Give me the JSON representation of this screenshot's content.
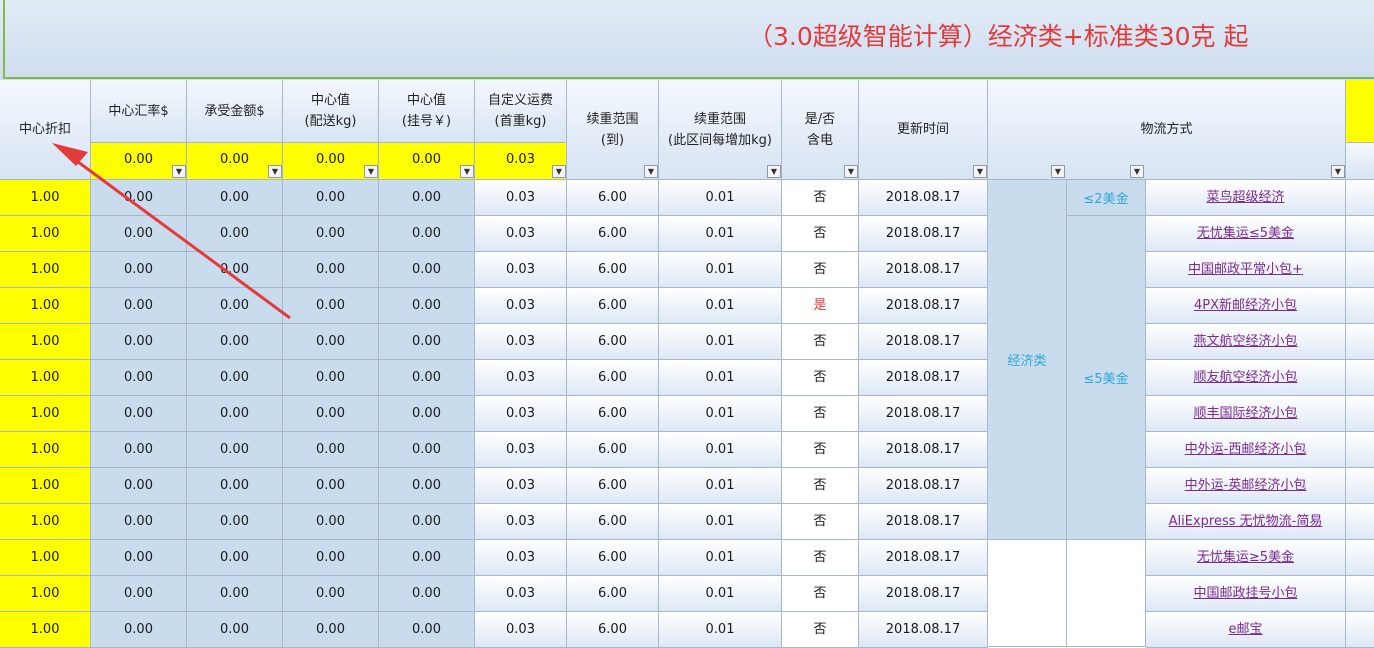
{
  "banner": {
    "title": "（3.0超级智能计算）经济类+标准类30克 起"
  },
  "headers": {
    "discount": "中心折扣",
    "rate": "中心汇率$",
    "amount": "承受金额$",
    "center_delivery": [
      "中心值",
      "(配送kg)"
    ],
    "center_registered": [
      "中心值",
      "(挂号￥)"
    ],
    "custom_freight": [
      "自定义运费",
      "(首重kg)"
    ],
    "continue_range_to": [
      "续重范围",
      "(到)"
    ],
    "continue_range_step": [
      "续重范围",
      "(此区间每增加kg)"
    ],
    "battery": [
      "是/否",
      "含电"
    ],
    "update_time": "更新时间",
    "shipping_method": "物流方式"
  },
  "inputs": {
    "rate": "0.00",
    "amount": "0.00",
    "center_delivery": "0.00",
    "center_registered": "0.00",
    "custom_freight": "0.03"
  },
  "groups": {
    "economy": "经济类",
    "le2": "≤2美金",
    "le5": "≤5美金"
  },
  "rows": [
    {
      "discount": "1.00",
      "rate": "0.00",
      "amount": "0.00",
      "delivery": "0.00",
      "registered": "0.00",
      "freight": "0.03",
      "range_to": "6.00",
      "range_step": "0.01",
      "battery": "否",
      "date": "2018.08.17",
      "method": "菜鸟超级经济"
    },
    {
      "discount": "1.00",
      "rate": "0.00",
      "amount": "0.00",
      "delivery": "0.00",
      "registered": "0.00",
      "freight": "0.03",
      "range_to": "6.00",
      "range_step": "0.01",
      "battery": "否",
      "date": "2018.08.17",
      "method": "无忧集运≤5美金"
    },
    {
      "discount": "1.00",
      "rate": "0.00",
      "amount": "0.00",
      "delivery": "0.00",
      "registered": "0.00",
      "freight": "0.03",
      "range_to": "6.00",
      "range_step": "0.01",
      "battery": "否",
      "date": "2018.08.17",
      "method": "中国邮政平常小包+"
    },
    {
      "discount": "1.00",
      "rate": "0.00",
      "amount": "0.00",
      "delivery": "0.00",
      "registered": "0.00",
      "freight": "0.03",
      "range_to": "6.00",
      "range_step": "0.01",
      "battery": "是",
      "date": "2018.08.17",
      "method": "4PX新邮经济小包"
    },
    {
      "discount": "1.00",
      "rate": "0.00",
      "amount": "0.00",
      "delivery": "0.00",
      "registered": "0.00",
      "freight": "0.03",
      "range_to": "6.00",
      "range_step": "0.01",
      "battery": "否",
      "date": "2018.08.17",
      "method": "燕文航空经济小包"
    },
    {
      "discount": "1.00",
      "rate": "0.00",
      "amount": "0.00",
      "delivery": "0.00",
      "registered": "0.00",
      "freight": "0.03",
      "range_to": "6.00",
      "range_step": "0.01",
      "battery": "否",
      "date": "2018.08.17",
      "method": "顺友航空经济小包"
    },
    {
      "discount": "1.00",
      "rate": "0.00",
      "amount": "0.00",
      "delivery": "0.00",
      "registered": "0.00",
      "freight": "0.03",
      "range_to": "6.00",
      "range_step": "0.01",
      "battery": "否",
      "date": "2018.08.17",
      "method": "顺丰国际经济小包"
    },
    {
      "discount": "1.00",
      "rate": "0.00",
      "amount": "0.00",
      "delivery": "0.00",
      "registered": "0.00",
      "freight": "0.03",
      "range_to": "6.00",
      "range_step": "0.01",
      "battery": "否",
      "date": "2018.08.17",
      "method": "中外运-西邮经济小包"
    },
    {
      "discount": "1.00",
      "rate": "0.00",
      "amount": "0.00",
      "delivery": "0.00",
      "registered": "0.00",
      "freight": "0.03",
      "range_to": "6.00",
      "range_step": "0.01",
      "battery": "否",
      "date": "2018.08.17",
      "method": "中外运-英邮经济小包"
    },
    {
      "discount": "1.00",
      "rate": "0.00",
      "amount": "0.00",
      "delivery": "0.00",
      "registered": "0.00",
      "freight": "0.03",
      "range_to": "6.00",
      "range_step": "0.01",
      "battery": "否",
      "date": "2018.08.17",
      "method": "AliExpress 无忧物流-简易"
    },
    {
      "discount": "1.00",
      "rate": "0.00",
      "amount": "0.00",
      "delivery": "0.00",
      "registered": "0.00",
      "freight": "0.03",
      "range_to": "6.00",
      "range_step": "0.01",
      "battery": "否",
      "date": "2018.08.17",
      "method": "无忧集运≥5美金"
    },
    {
      "discount": "1.00",
      "rate": "0.00",
      "amount": "0.00",
      "delivery": "0.00",
      "registered": "0.00",
      "freight": "0.03",
      "range_to": "6.00",
      "range_step": "0.01",
      "battery": "否",
      "date": "2018.08.17",
      "method": "中国邮政挂号小包"
    },
    {
      "discount": "1.00",
      "rate": "0.00",
      "amount": "0.00",
      "delivery": "0.00",
      "registered": "0.00",
      "freight": "0.03",
      "range_to": "6.00",
      "range_step": "0.01",
      "battery": "否",
      "date": "2018.08.17",
      "method": "e邮宝"
    }
  ],
  "colors": {
    "accent_red": "#e33b3b",
    "input_yellow": "#ffff00",
    "group_text": "#2fa6d8",
    "link": "#7c2b91"
  },
  "icons": {
    "filter": "dropdown-filter-icon",
    "annotation": "red-arrow-icon"
  }
}
